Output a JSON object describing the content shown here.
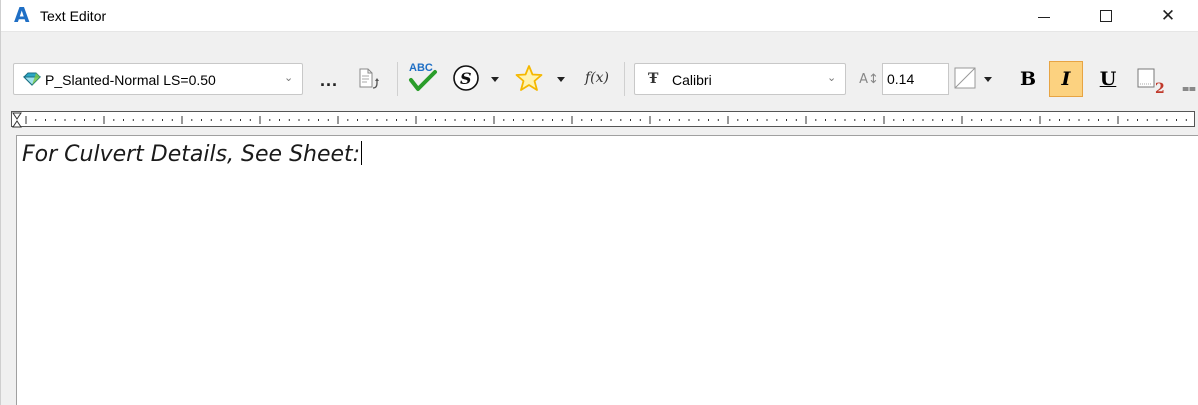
{
  "window": {
    "title": "Text Editor",
    "logo": "A",
    "controls": [
      "minimize",
      "maximize",
      "close"
    ],
    "close_glyph": "✕"
  },
  "toolbar": {
    "text_style": "P_Slanted-Normal LS=0.50",
    "text_style_icon": "style-gem-icon",
    "more_label": "...",
    "font": "Calibri",
    "font_icon": "Ŧ",
    "text_height": "0.14",
    "fx_label": "f(x)",
    "bold_label": "B",
    "italic_label": "I",
    "underline_label": "U",
    "italic_active": true,
    "overflow_glyph": "⩵"
  },
  "colors": {
    "accent": "#1f6fc5",
    "italic_active_bg": "#fcd280",
    "italic_active_border": "#e7a443",
    "spell_check": "#2a9d2a",
    "star": "#f5b800",
    "subscript": "#c0392b"
  },
  "editor": {
    "content": "For Culvert Details, See Sheet:"
  }
}
